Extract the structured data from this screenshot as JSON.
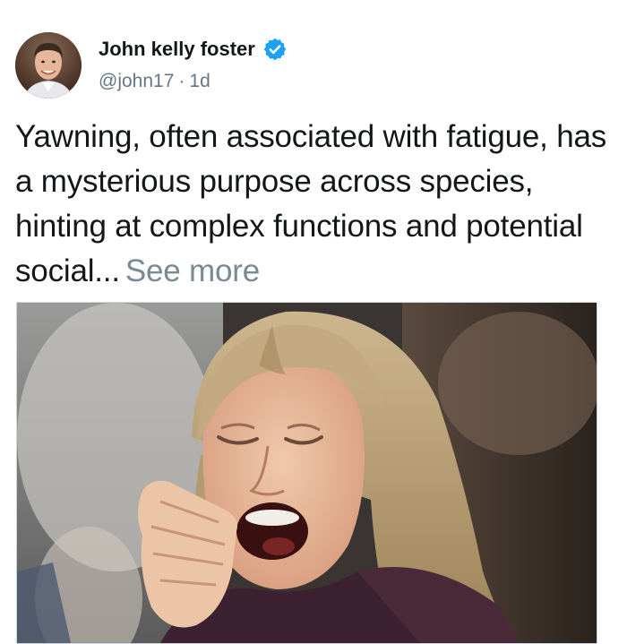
{
  "author": {
    "name": "John kelly foster",
    "handle": "@john17",
    "separator": "·",
    "time": "1d",
    "verified_color": "#1da1f2"
  },
  "tweet": {
    "text": "Yawning, often associated with fatigue, has a mysterious purpose across species, hinting at complex functions and potential social...",
    "see_more": "See more"
  },
  "media": {
    "description_icon": "photo-woman-yawning"
  }
}
